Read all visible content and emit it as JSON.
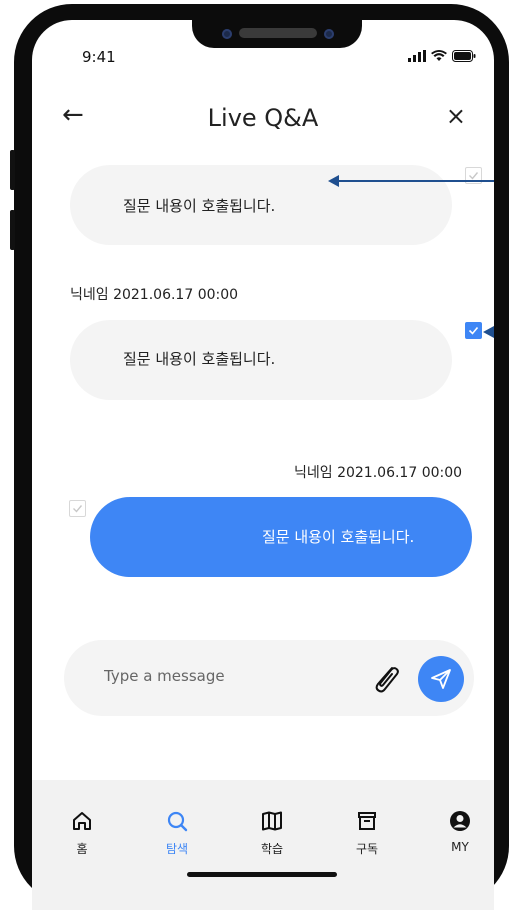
{
  "status": {
    "time": "9:41"
  },
  "header": {
    "title": "Live Q&A",
    "back_icon": "←",
    "close_icon": "×"
  },
  "messages": [
    {
      "text": "질문 내용이 호출됩니다.",
      "checked": false,
      "side": "left"
    },
    {
      "nickname": "닉네임 2021.06.17  00:00",
      "text": "질문 내용이 호출됩니다.",
      "checked": true,
      "side": "left"
    },
    {
      "nickname": "닉네임 2021.06.17  00:00",
      "text": "질문 내용이 호출됩니다.",
      "checked": false,
      "side": "right"
    }
  ],
  "composer": {
    "placeholder": "Type a message"
  },
  "tabbar": {
    "items": [
      {
        "label": "홈",
        "icon": "home-icon"
      },
      {
        "label": "탐색",
        "icon": "search-icon",
        "active": true
      },
      {
        "label": "학습",
        "icon": "book-icon"
      },
      {
        "label": "구독",
        "icon": "archive-icon"
      },
      {
        "label": "MY",
        "icon": "user-icon"
      }
    ]
  },
  "colors": {
    "accent": "#3e86f5",
    "bubble": "#f4f4f4",
    "annotation": "#1f4f8f"
  }
}
